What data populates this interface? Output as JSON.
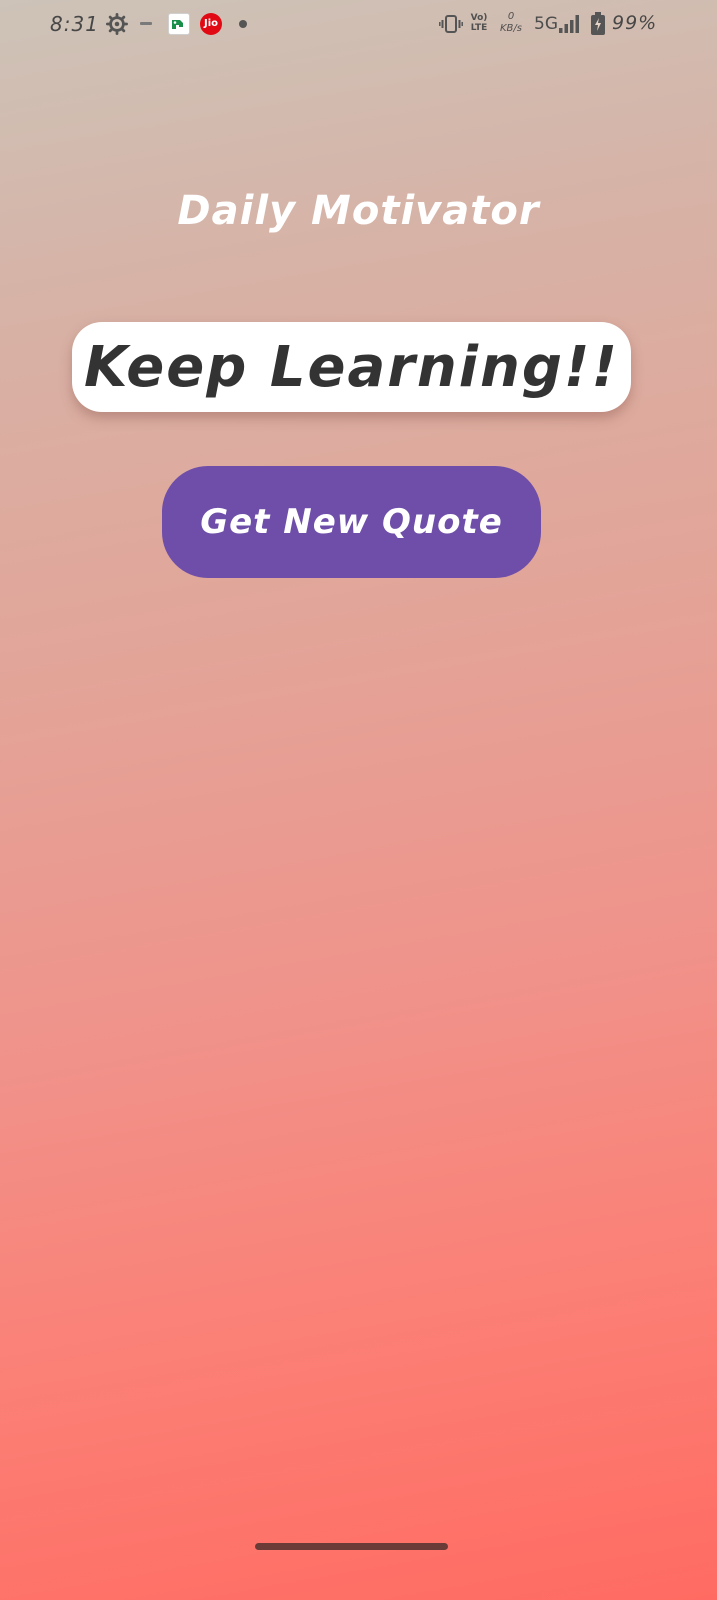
{
  "status_bar": {
    "time": "8:31",
    "jio_label": "Jio",
    "volte_label": [
      "Vo)",
      "LTE"
    ],
    "speed_value": "0",
    "speed_unit": "KB/s",
    "network": "5G",
    "battery": "99%",
    "icons": [
      "gear-icon",
      "dash-icon",
      "app-notif-icon",
      "jio-icon",
      "dot-icon",
      "vibrate-icon",
      "volte-icon",
      "speed-icon",
      "signal-icon",
      "battery-icon"
    ]
  },
  "app": {
    "title": "Daily Motivator",
    "quote": "Keep Learning!!",
    "button_label": "Get New Quote"
  },
  "colors": {
    "button": "#6e4ea9",
    "title_text": "#ffffff",
    "quote_text": "#333333",
    "background_top": "#cdc3b8",
    "background_bottom": "#ff6b62"
  }
}
